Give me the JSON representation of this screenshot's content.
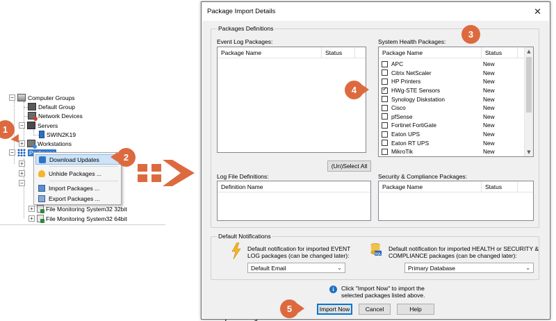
{
  "tree": {
    "items": [
      {
        "label": "Computer Groups"
      },
      {
        "label": "Default Group"
      },
      {
        "label": "Network Devices"
      },
      {
        "label": "Servers"
      },
      {
        "label": "SWIN2K19"
      },
      {
        "label": "Workstations"
      },
      {
        "label": "Packages"
      },
      {
        "label": "File Monitoring System32 32bit"
      },
      {
        "label": "File Monitoring System32 64bit"
      }
    ]
  },
  "context_menu": {
    "items": [
      {
        "label": "Download Updates",
        "icon": "download-icon"
      },
      {
        "label": "Unhide Packages ...",
        "icon": "lightbulb-icon"
      },
      {
        "label": "Import Packages ...",
        "icon": "import-icon"
      },
      {
        "label": "Export Packages ...",
        "icon": "export-icon"
      }
    ]
  },
  "callouts": [
    "1",
    "2",
    "3",
    "4",
    "5"
  ],
  "dialog": {
    "title": "Package Import Details",
    "close_glyph": "✕",
    "definitions_group": "Packages  Definitions",
    "event_log": {
      "label": "Event Log Packages:",
      "columns": [
        "Package Name",
        "Status"
      ]
    },
    "system_health": {
      "label": "System Health Packages:",
      "columns": [
        "Package Name",
        "Status"
      ],
      "rows": [
        {
          "name": "APC",
          "status": "New",
          "checked": false
        },
        {
          "name": "Citrix NetScaler",
          "status": "New",
          "checked": false
        },
        {
          "name": "HP Printers",
          "status": "New",
          "checked": false
        },
        {
          "name": "HWg-STE Sensors",
          "status": "New",
          "checked": true
        },
        {
          "name": "Synology Diskstation",
          "status": "New",
          "checked": false
        },
        {
          "name": "Cisco",
          "status": "New",
          "checked": false
        },
        {
          "name": "pfSense",
          "status": "New",
          "checked": false
        },
        {
          "name": "Fortinet FortiGate",
          "status": "New",
          "checked": false
        },
        {
          "name": "Eaton UPS",
          "status": "New",
          "checked": false
        },
        {
          "name": "Eaton RT UPS",
          "status": "New",
          "checked": false
        },
        {
          "name": "MikroTik",
          "status": "New",
          "checked": false
        }
      ]
    },
    "select_all_button": "(Un)Select All",
    "log_file": {
      "label": "Log File Definitions:",
      "columns": [
        "Definition Name"
      ]
    },
    "security": {
      "label": "Security & Compliance Packages:",
      "columns": [
        "Package Name",
        "Status"
      ]
    },
    "notifications": {
      "group": "Default Notifications",
      "left_text_1": "Default notification for imported EVENT",
      "left_text_2": "LOG packages (can be changed later):",
      "left_value": "Default Email",
      "right_text_1": "Default notification for imported HEALTH or SECURITY &",
      "right_text_2": "COMPLIANCE packages (can be changed later):",
      "right_value": "Primary Database",
      "db_label": "SQL"
    },
    "info_text_1": "Click \"Import Now\" to import the",
    "info_text_2": "selected packages listed above.",
    "buttons": {
      "import": "Import Now",
      "cancel": "Cancel",
      "help": "Help"
    }
  },
  "background_text": "on Scripts Packages",
  "colors": {
    "callout": "#dd6a3f",
    "selection": "#3377cc",
    "menu_highlight": "#cde3f8"
  }
}
